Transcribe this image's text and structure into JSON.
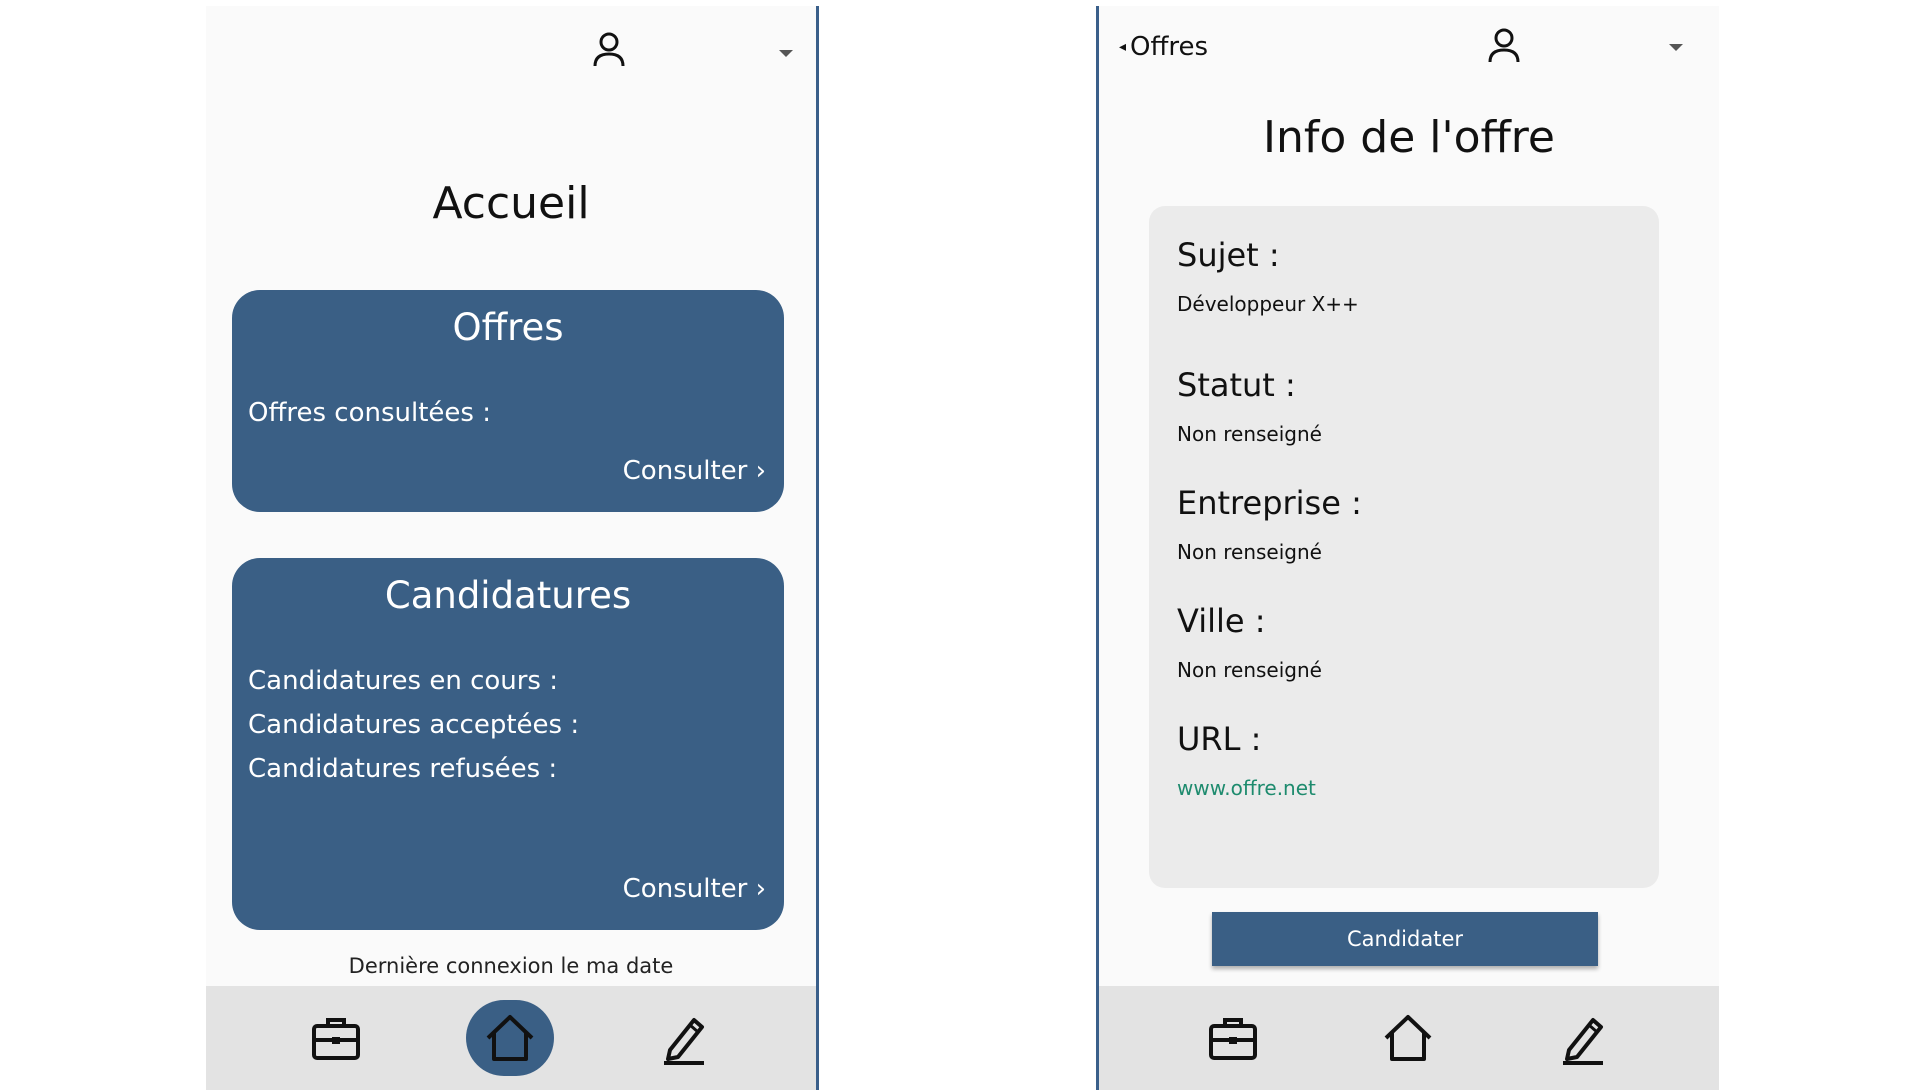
{
  "left_screen": {
    "title": "Accueil",
    "offres_card": {
      "title": "Offres",
      "lines": [
        "Offres consultées :"
      ],
      "link": "Consulter ›"
    },
    "candidatures_card": {
      "title": "Candidatures",
      "lines": [
        "Candidatures en cours :",
        "Candidatures acceptées :",
        "Candidatures refusées :"
      ],
      "link": "Consulter ›"
    },
    "last_login": "Dernière connexion le ma date",
    "nav": {
      "active": "home",
      "items": [
        "briefcase-icon",
        "home-icon",
        "pencil-icon"
      ]
    }
  },
  "right_screen": {
    "back_label": "Offres",
    "title": "Info de l'offre",
    "fields": [
      {
        "label": "Sujet :",
        "value": "Développeur X++"
      },
      {
        "label": "Statut :",
        "value": "Non renseigné"
      },
      {
        "label": "Entreprise :",
        "value": "Non renseigné"
      },
      {
        "label": "Ville :",
        "value": "Non renseigné"
      },
      {
        "label": "URL :",
        "value": "www.offre.net"
      }
    ],
    "apply_label": "Candidater",
    "nav": {
      "active": "none",
      "items": [
        "briefcase-icon",
        "home-icon",
        "pencil-icon"
      ]
    }
  },
  "colors": {
    "primary": "#3a5f85",
    "nav_bg": "#e3e3e3",
    "link": "#1e8b6e",
    "panel": "#ebebeb"
  }
}
